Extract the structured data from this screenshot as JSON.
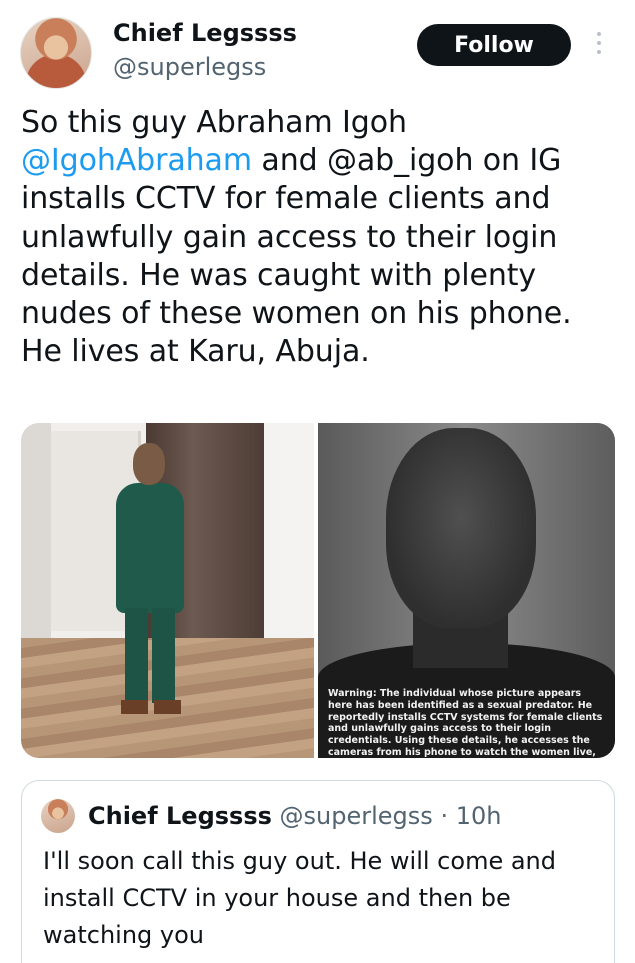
{
  "author": {
    "display_name": "Chief Legssss",
    "handle": "@superlegss"
  },
  "follow_label": "Follow",
  "tweet": {
    "part1": "So this guy Abraham Igoh ",
    "mention1": "@IgohAbraham",
    "part2": " and @ab_igoh on IG installs CCTV for female clients and unlawfully gain access to their login details. He was caught with plenty nudes of these women on his phone. He lives at Karu, Abuja."
  },
  "media": {
    "warning_text": "Warning: The individual whose picture appears here has been identified as a sexual predator. He reportedly installs CCTV systems for female clients and unlawfully gains access to their login credentials. Using these details, he accesses the cameras from his phone to watch the women live, often recording explicit footage"
  },
  "quoted_tweet": {
    "display_name": "Chief Legssss",
    "handle": "@superlegss",
    "time_ago": "10h",
    "separator": "·",
    "text": "I'll soon call this guy out. He will come and install CCTV in your house and then be watching you"
  },
  "colors": {
    "accent": "#1d9bf0",
    "follow_bg": "#0f1419",
    "secondary_text": "#536471"
  }
}
